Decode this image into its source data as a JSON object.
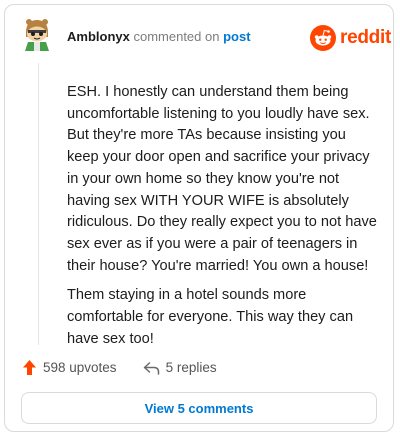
{
  "header": {
    "username": "Amblonyx",
    "commented_on": "commented on",
    "post_link": "post",
    "brand": "reddit"
  },
  "comment": {
    "paragraphs": [
      "ESH. I honestly can understand them being uncomfortable listening to you loudly have sex. But they're more TAs because insisting you keep your door open and sacrifice your privacy in your own home so they know you're not having sex WITH YOUR WIFE is absolutely ridiculous. Do they really expect you to not have sex ever as if you were a pair of teenagers in their house? You're married! You own a house!",
      "Them staying in a hotel sounds more comfortable for everyone. This way they can have sex too!"
    ]
  },
  "actions": {
    "upvotes": "598 upvotes",
    "replies": "5 replies"
  },
  "footer": {
    "view_comments": "View 5 comments"
  },
  "colors": {
    "brand": "#ff4500",
    "link": "#0079d3",
    "upvote": "#ff4500"
  },
  "icons": {
    "avatar": "snoo-avatar-icon",
    "brand": "reddit-logo-icon",
    "upvote": "upvote-arrow-icon",
    "reply": "reply-arrow-icon"
  }
}
